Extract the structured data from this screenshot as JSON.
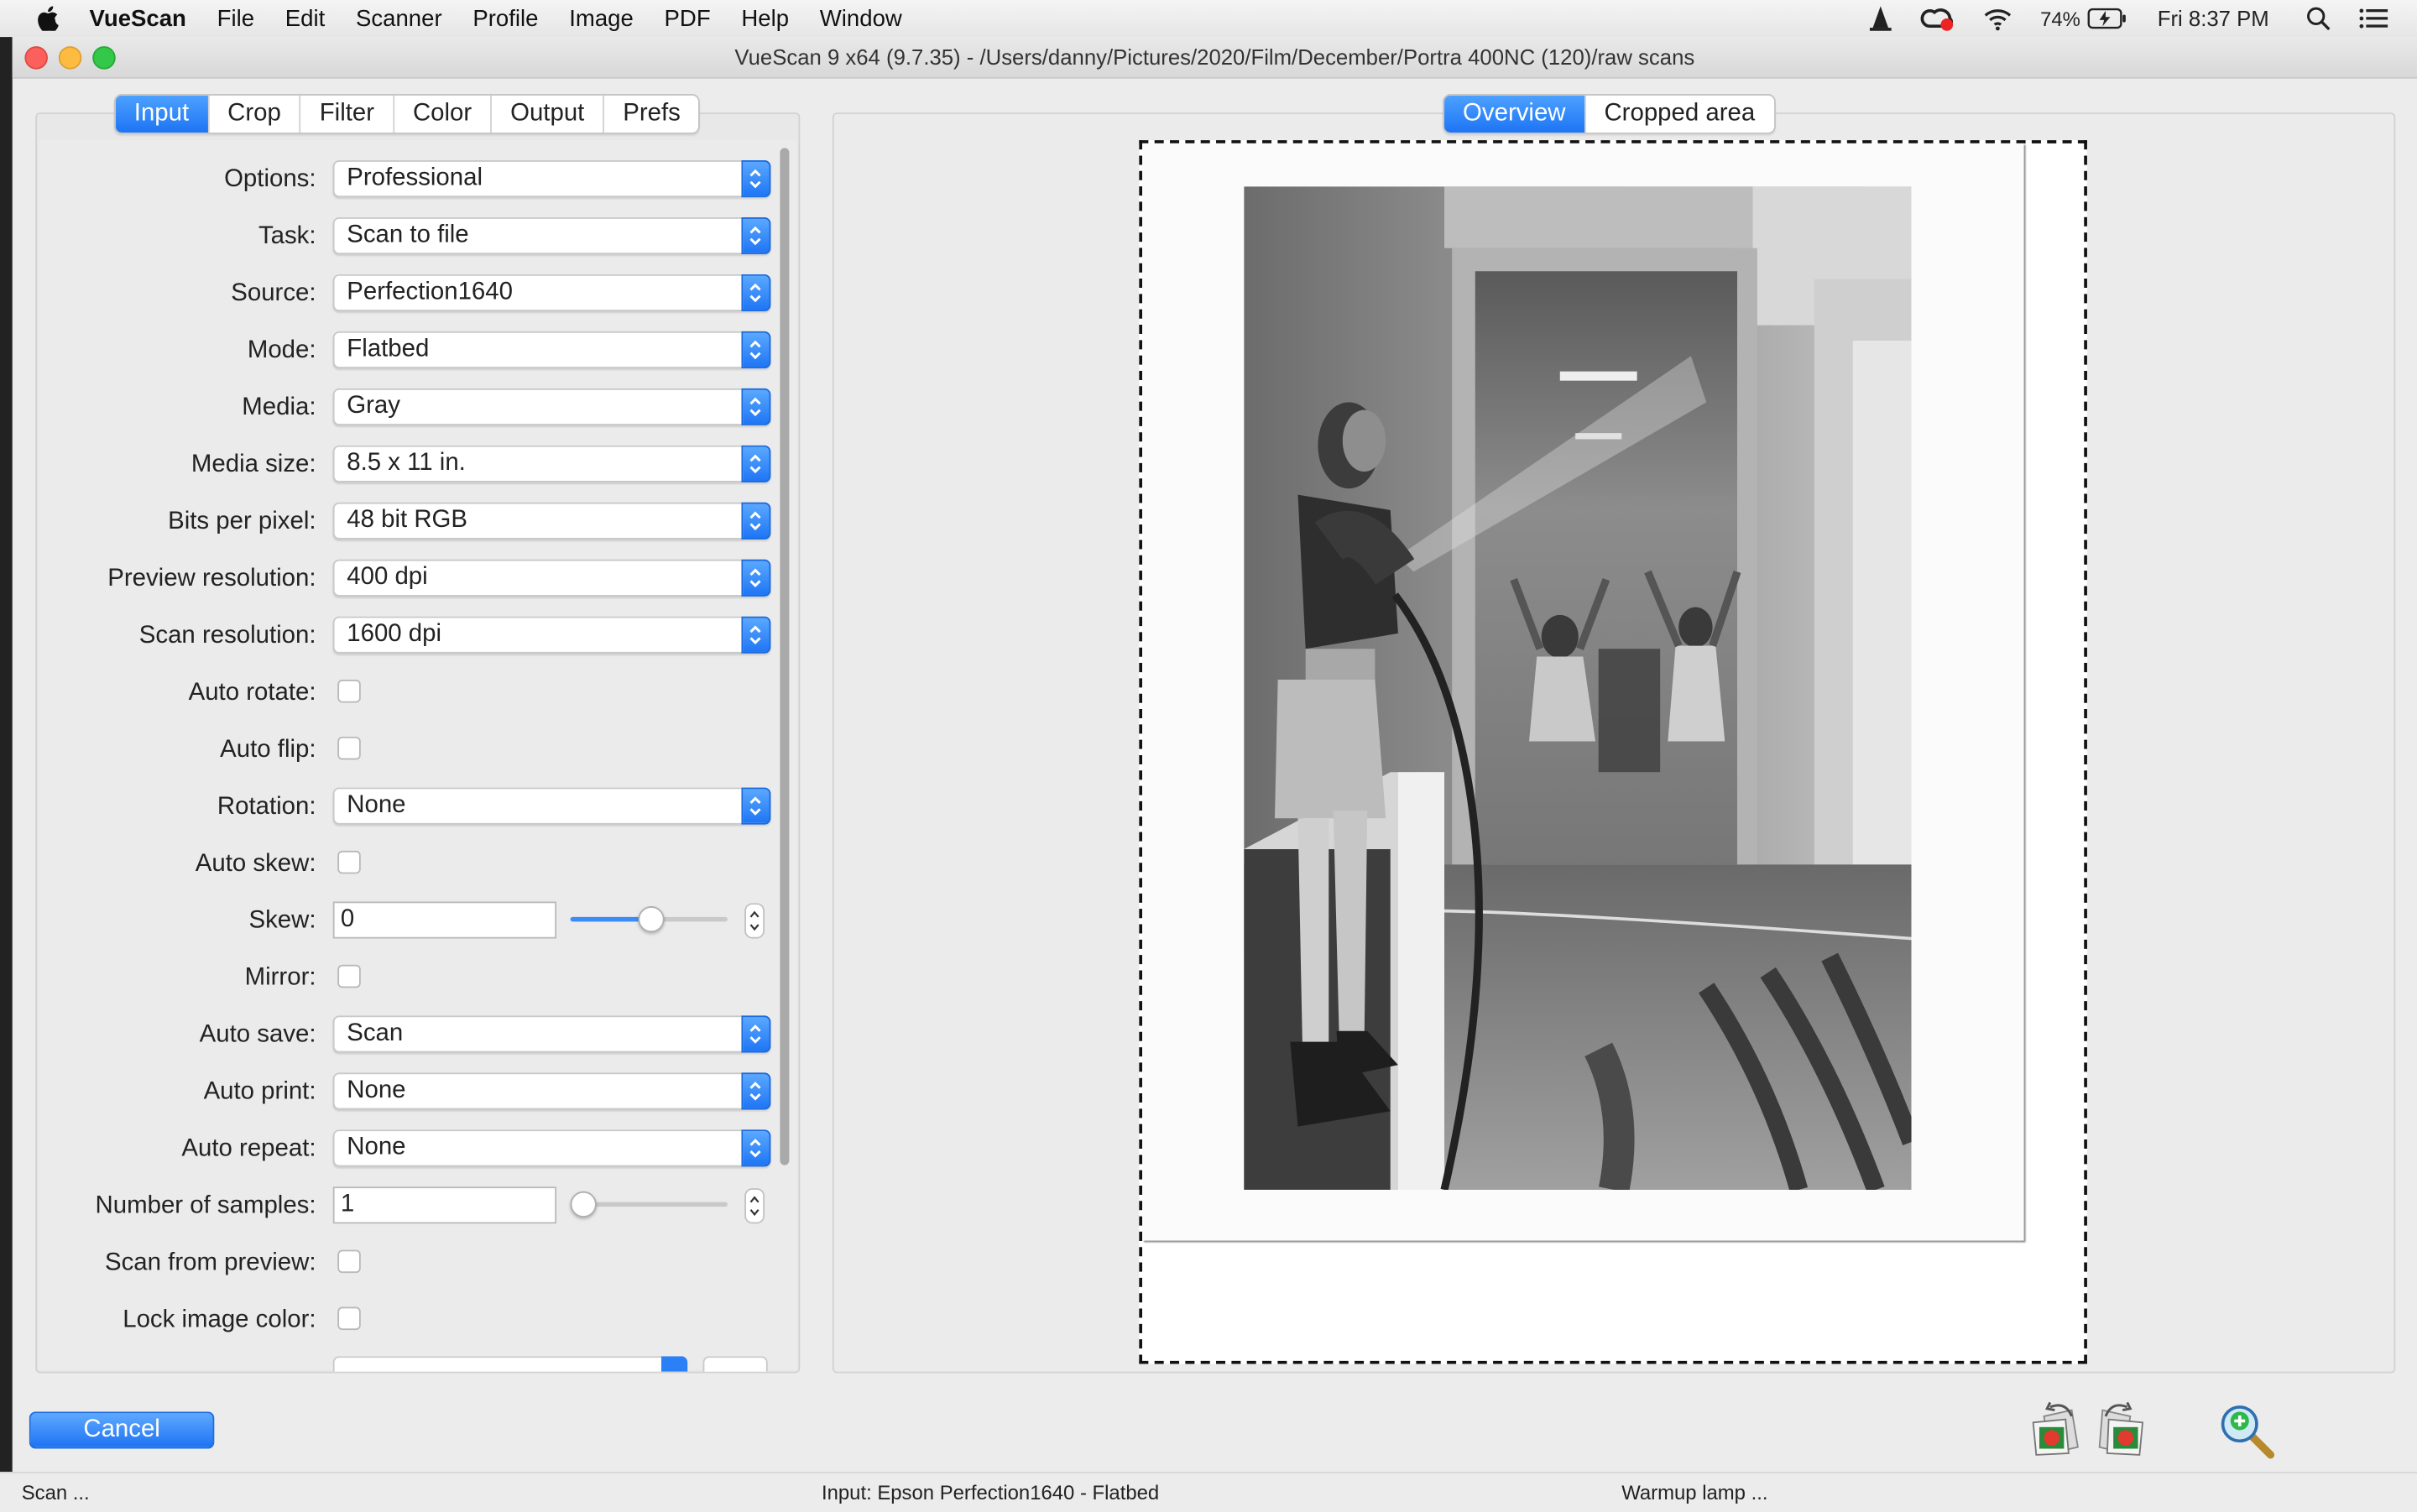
{
  "menubar": {
    "app_name": "VueScan",
    "items": [
      "File",
      "Edit",
      "Scanner",
      "Profile",
      "Image",
      "PDF",
      "Help",
      "Window"
    ],
    "battery": "74%",
    "clock": "Fri 8:37 PM"
  },
  "window": {
    "title": "VueScan 9 x64 (9.7.35) - /Users/danny/Pictures/2020/Film/December/Portra 400NC (120)/raw scans"
  },
  "left_tabs": [
    "Input",
    "Crop",
    "Filter",
    "Color",
    "Output",
    "Prefs"
  ],
  "left_tabs_active": "Input",
  "view_tabs": [
    "Overview",
    "Cropped area"
  ],
  "view_tabs_active": "Overview",
  "fields": {
    "options": {
      "label": "Options:",
      "value": "Professional"
    },
    "task": {
      "label": "Task:",
      "value": "Scan to file"
    },
    "source": {
      "label": "Source:",
      "value": "Perfection1640"
    },
    "mode": {
      "label": "Mode:",
      "value": "Flatbed"
    },
    "media": {
      "label": "Media:",
      "value": "Gray"
    },
    "media_size": {
      "label": "Media size:",
      "value": "8.5 x 11 in."
    },
    "bits_per_pixel": {
      "label": "Bits per pixel:",
      "value": "48 bit RGB"
    },
    "preview_resolution": {
      "label": "Preview resolution:",
      "value": "400 dpi"
    },
    "scan_resolution": {
      "label": "Scan resolution:",
      "value": "1600 dpi"
    },
    "auto_rotate": {
      "label": "Auto rotate:",
      "checked": false
    },
    "auto_flip": {
      "label": "Auto flip:",
      "checked": false
    },
    "rotation": {
      "label": "Rotation:",
      "value": "None"
    },
    "auto_skew": {
      "label": "Auto skew:",
      "checked": false
    },
    "skew": {
      "label": "Skew:",
      "value": "0",
      "slider_fraction": 0.5
    },
    "mirror": {
      "label": "Mirror:",
      "checked": false
    },
    "auto_save": {
      "label": "Auto save:",
      "value": "Scan"
    },
    "auto_print": {
      "label": "Auto print:",
      "value": "None"
    },
    "auto_repeat": {
      "label": "Auto repeat:",
      "value": "None"
    },
    "number_of_samples": {
      "label": "Number of samples:",
      "value": "1",
      "slider_fraction": 0.0
    },
    "scan_from_preview": {
      "label": "Scan from preview:",
      "checked": false
    },
    "lock_image_color": {
      "label": "Lock image color:",
      "checked": false
    }
  },
  "buttons": {
    "cancel": "Cancel"
  },
  "toolbar_icons": [
    "rotate-left-icon",
    "rotate-right-icon",
    "zoom-in-icon"
  ],
  "status": {
    "left": "Scan ...",
    "center": "Input: Epson Perfection1640 - Flatbed",
    "right": "Warmup lamp ..."
  },
  "colors": {
    "accent": "#1d74f5",
    "window_bg": "#ececec"
  }
}
